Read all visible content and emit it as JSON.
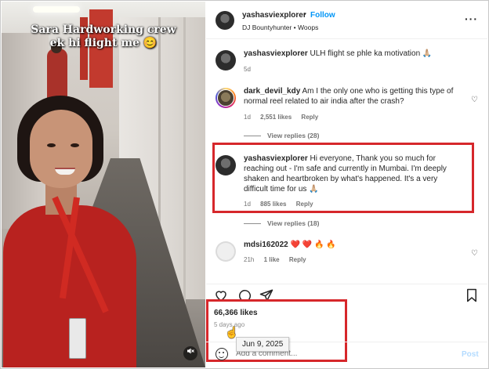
{
  "media": {
    "caption": "Sara Hardworking crew ek hi flight me 😊",
    "mute_icon": "speaker-muted-icon"
  },
  "header": {
    "username": "yashasviexplorer",
    "separator": "•",
    "follow_label": "Follow",
    "audio": "DJ Bountyhunter • Woops",
    "more_icon": "ellipsis-icon"
  },
  "comments": [
    {
      "username": "yashasviexplorer",
      "text": "ULH flight se phle ka motivation 🙏🏼",
      "time": "5d"
    },
    {
      "username": "dark_devil_kdy",
      "text": "Am I the only one who is getting this type of normal reel related to air india after the crash?",
      "time": "1d",
      "likes": "2,551 likes",
      "reply": "Reply",
      "view_replies": "View replies (28)"
    },
    {
      "username": "yashasviexplorer",
      "text": "Hi everyone, Thank you so much for reaching out - I'm safe and currently in Mumbai. I'm deeply shaken and heartbroken by what's happened. It's a very difficult time for us 🙏🏼",
      "time": "1d",
      "likes": "885 likes",
      "reply": "Reply",
      "view_replies": "View replies (18)"
    },
    {
      "username": "mdsi162022",
      "text": "❤️ ❤️ 🔥 🔥",
      "time": "21h",
      "likes": "1 like",
      "reply": "Reply"
    }
  ],
  "actions": {
    "like_icon": "heart-icon",
    "comment_icon": "comment-icon",
    "share_icon": "share-icon",
    "save_icon": "bookmark-icon"
  },
  "post_stats": {
    "likes": "66,366 likes",
    "ago": "5 days ago",
    "tooltip_date": "Jun 9, 2025"
  },
  "add_comment": {
    "placeholder": "Add a comment...",
    "post_label": "Post"
  },
  "colors": {
    "accent_blue": "#0095f6",
    "highlight_red": "#d6272b"
  }
}
